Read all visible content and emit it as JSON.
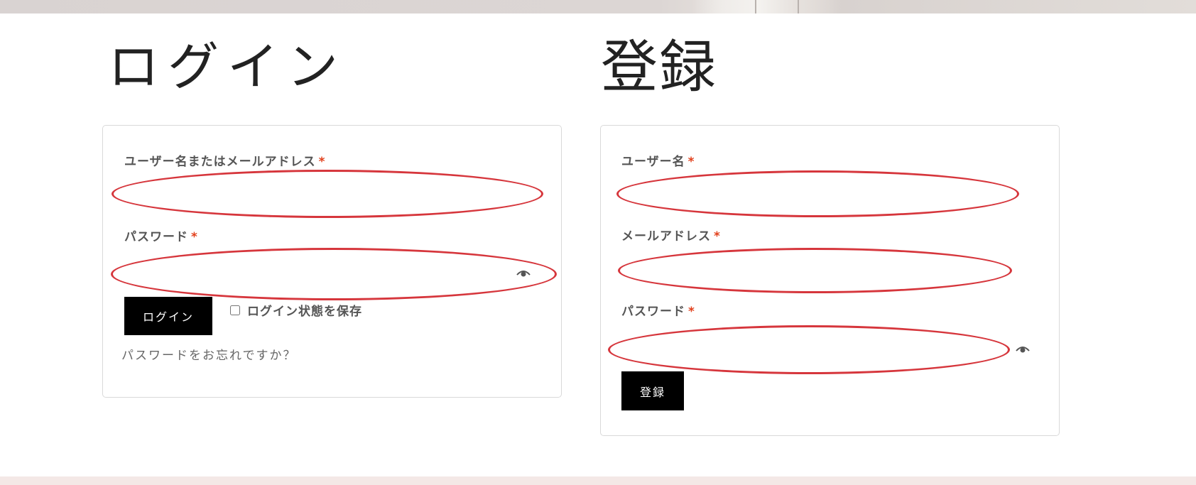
{
  "login": {
    "title": "ログイン",
    "username_label": "ユーザー名またはメールアドレス",
    "username_value": "",
    "password_label": "パスワード",
    "password_value": "",
    "required_mark": "*",
    "submit_label": "ログイン",
    "remember_label": "ログイン状態を保存",
    "remember_checked": false,
    "forgot_link": "パスワードをお忘れですか？"
  },
  "register": {
    "title": "登録",
    "username_label": "ユーザー名",
    "username_value": "",
    "email_label": "メールアドレス",
    "email_value": "",
    "password_label": "パスワード",
    "password_value": "",
    "required_mark": "*",
    "submit_label": "登録"
  },
  "icons": {
    "password_toggle": "eye-icon"
  },
  "colors": {
    "annotation_oval": "#d6363c",
    "required_asterisk": "#e2401c",
    "button_bg": "#000000",
    "bottom_band": "#f4e8e6"
  }
}
